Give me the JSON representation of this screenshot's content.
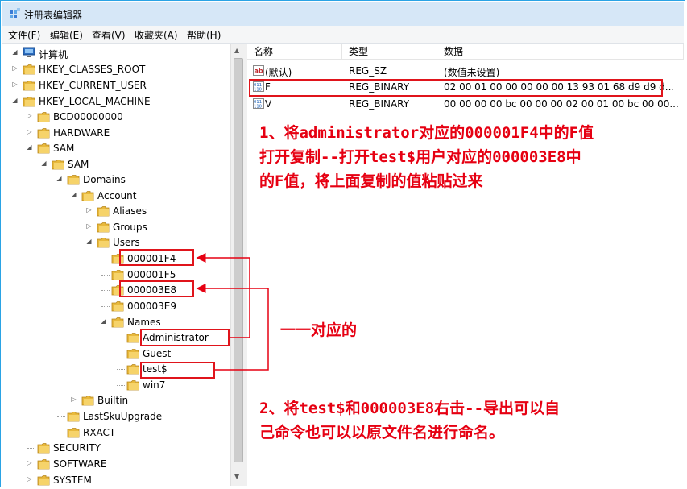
{
  "window": {
    "title": "注册表编辑器"
  },
  "menu": [
    "文件(F)",
    "编辑(E)",
    "查看(V)",
    "收藏夹(A)",
    "帮助(H)"
  ],
  "tree": {
    "root": "计算机",
    "nodes": [
      {
        "label": "HKEY_CLASSES_ROOT"
      },
      {
        "label": "HKEY_CURRENT_USER"
      },
      {
        "label": "HKEY_LOCAL_MACHINE"
      },
      {
        "label": "BCD00000000"
      },
      {
        "label": "HARDWARE"
      },
      {
        "label": "SAM"
      },
      {
        "label": "SAM"
      },
      {
        "label": "Domains"
      },
      {
        "label": "Account"
      },
      {
        "label": "Aliases"
      },
      {
        "label": "Groups"
      },
      {
        "label": "Users"
      },
      {
        "label": "000001F4"
      },
      {
        "label": "000001F5"
      },
      {
        "label": "000003E8"
      },
      {
        "label": "000003E9"
      },
      {
        "label": "Names"
      },
      {
        "label": "Administrator"
      },
      {
        "label": "Guest"
      },
      {
        "label": "test$"
      },
      {
        "label": "win7"
      },
      {
        "label": "Builtin"
      },
      {
        "label": "LastSkuUpgrade"
      },
      {
        "label": "RXACT"
      },
      {
        "label": "SECURITY"
      },
      {
        "label": "SOFTWARE"
      },
      {
        "label": "SYSTEM"
      }
    ]
  },
  "values": {
    "columns": [
      "名称",
      "类型",
      "数据"
    ],
    "rows": [
      {
        "name": "(默认)",
        "type": "REG_SZ",
        "data": "(数值未设置)"
      },
      {
        "name": "F",
        "type": "REG_BINARY",
        "data": "02 00 01 00 00 00 00 00 13 93 01 68 d9 d9 d..."
      },
      {
        "name": "V",
        "type": "REG_BINARY",
        "data": "00 00 00 00 bc 00 00 00 02 00 01 00 bc 00 00..."
      }
    ]
  },
  "annotations": {
    "note1": [
      "1、将administrator对应的000001F4中的F值",
      "打开复制--打开test$用户对应的000003E8中",
      "的F值，将上面复制的值粘贴过来"
    ],
    "note2": "一一对应的",
    "note3": [
      "2、将test$和000003E8右击--导出可以自",
      "己命令也可以以原文件名进行命名。"
    ]
  },
  "colors": {
    "annotation": "#e60012",
    "titlebar": "#d6e7f7",
    "folder": "#e8b93c"
  }
}
